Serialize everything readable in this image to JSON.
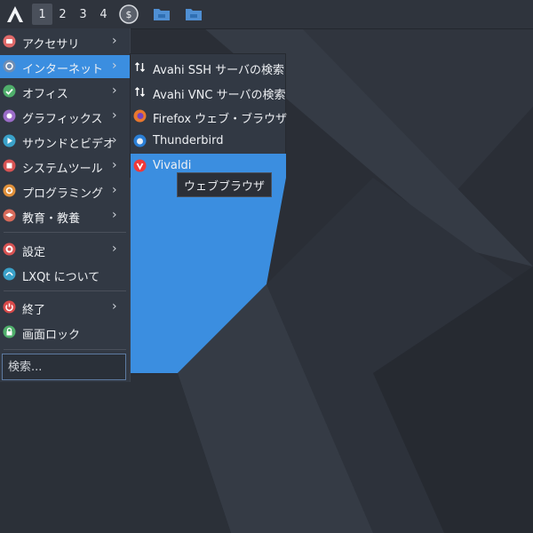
{
  "panel": {
    "desktops": [
      "1",
      "2",
      "3",
      "4"
    ],
    "active_desktop": "1",
    "tray": {
      "money_icon_text": "$"
    }
  },
  "menu": {
    "items": [
      {
        "label": "アクセサリ",
        "icon": "accessories-icon",
        "color": "#e06a6a",
        "submenu": true
      },
      {
        "label": "インターネット",
        "icon": "internet-icon",
        "color": "#6f8db3",
        "submenu": true,
        "active": true
      },
      {
        "label": "オフィス",
        "icon": "office-icon",
        "color": "#4fae6b",
        "submenu": true
      },
      {
        "label": "グラフィックス",
        "icon": "graphics-icon",
        "color": "#9b6cc8",
        "submenu": true
      },
      {
        "label": "サウンドとビデオ",
        "icon": "sound-video-icon",
        "color": "#3aa1c9",
        "submenu": true
      },
      {
        "label": "システムツール",
        "icon": "system-tools-icon",
        "color": "#d85353",
        "submenu": true
      },
      {
        "label": "プログラミング",
        "icon": "programming-icon",
        "color": "#e0903a",
        "submenu": true
      },
      {
        "label": "教育・教養",
        "icon": "education-icon",
        "color": "#d86a5a",
        "submenu": true
      },
      {
        "label": "設定",
        "icon": "settings-icon",
        "color": "#d85353",
        "submenu": true
      },
      {
        "label": "LXQt について",
        "icon": "lxqt-about-icon",
        "color": "#3aa1c9",
        "submenu": false
      },
      {
        "label": "終了",
        "icon": "shutdown-icon",
        "color": "#d84a4a",
        "submenu": true
      },
      {
        "label": "画面ロック",
        "icon": "lock-icon",
        "color": "#4fae6b",
        "submenu": false
      }
    ],
    "search_placeholder": "検索..."
  },
  "submenu": {
    "items": [
      {
        "label": "Avahi SSH サーバの検索",
        "icon": "transfer-arrows-icon"
      },
      {
        "label": "Avahi VNC サーバの検索",
        "icon": "transfer-arrows-icon"
      },
      {
        "label": "Firefox ウェブ・ブラウザ",
        "icon": "firefox-icon"
      },
      {
        "label": "Thunderbird",
        "icon": "thunderbird-icon"
      },
      {
        "label": "Vivaldi",
        "icon": "vivaldi-icon",
        "active": true
      }
    ]
  },
  "tooltip": {
    "text": "ウェブブラウザ"
  },
  "colors": {
    "accent": "#3b8ee0",
    "panel": "#2f343d",
    "menu_bg": "#323944",
    "desktop": "#2a2e36"
  }
}
